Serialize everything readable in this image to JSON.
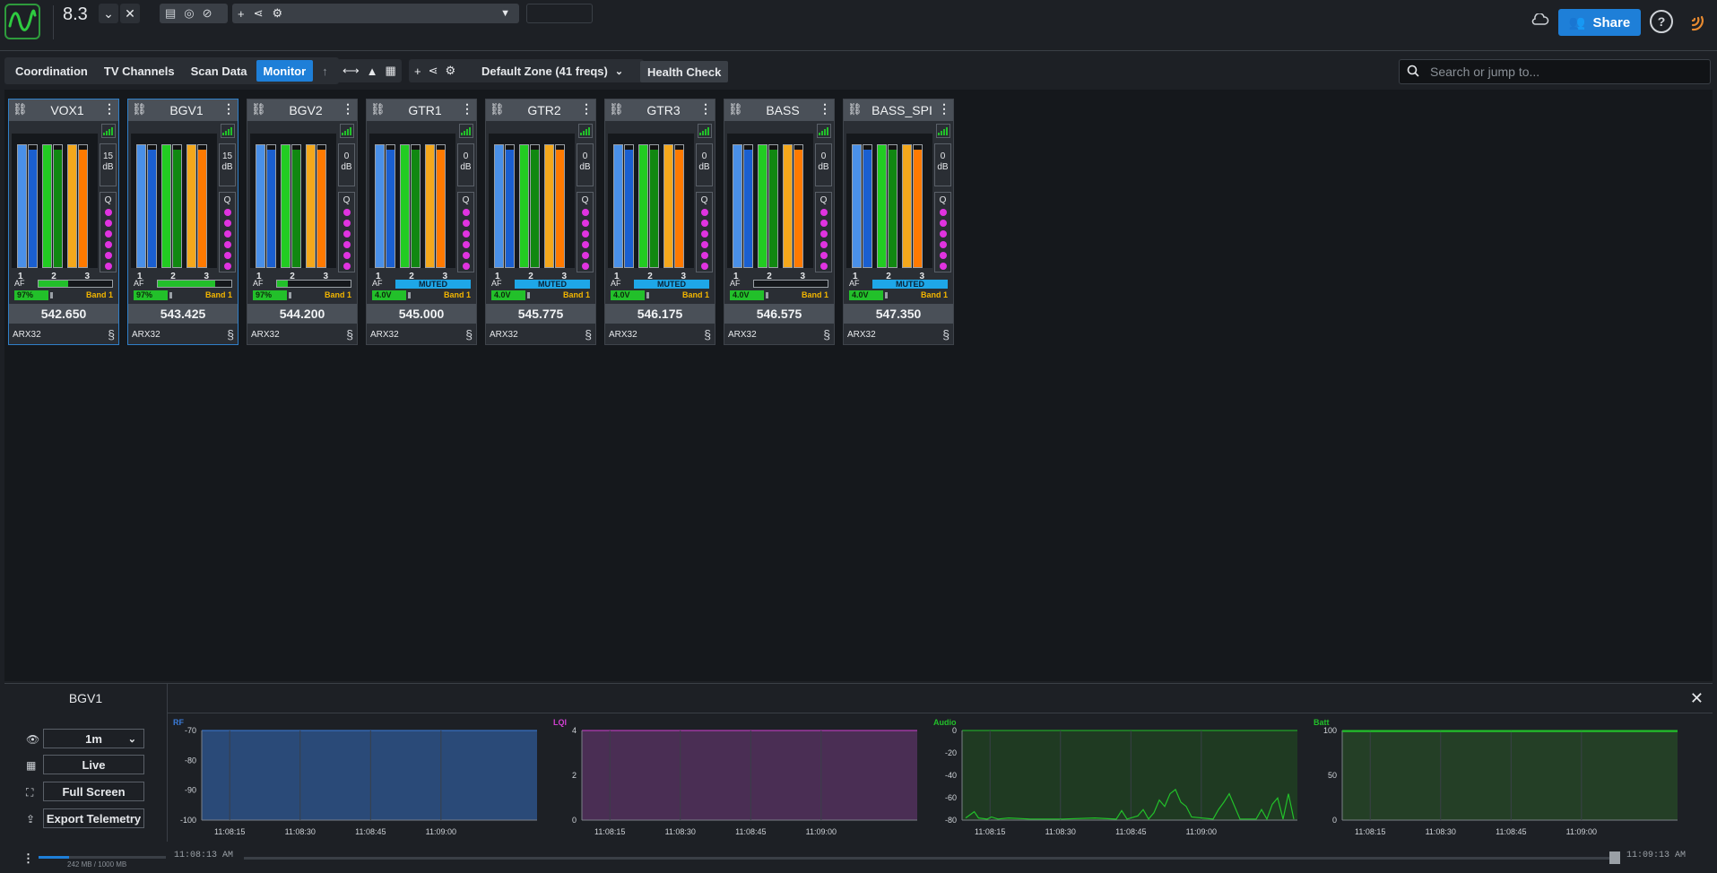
{
  "app": {
    "version": "8.3"
  },
  "toolbar": {
    "share_label": "Share"
  },
  "nav": {
    "tabs": [
      {
        "label": "Coordination",
        "active": false
      },
      {
        "label": "TV Channels",
        "active": false
      },
      {
        "label": "Scan Data",
        "active": false
      },
      {
        "label": "Monitor",
        "active": true
      }
    ],
    "zone_label": "Default Zone (41 freqs)",
    "health_check": "Health Check"
  },
  "search": {
    "placeholder": "Search or jump to..."
  },
  "channels": [
    {
      "name": "VOX1",
      "freq": "542.650",
      "model": "ARX32",
      "gain": "15",
      "gain_unit": "dB",
      "af_label": "AF",
      "af_level": 0.4,
      "muted": false,
      "battery": "97%",
      "band": "Band 1",
      "selected": true
    },
    {
      "name": "BGV1",
      "freq": "543.425",
      "model": "ARX32",
      "gain": "15",
      "gain_unit": "dB",
      "af_label": "AF",
      "af_level": 0.78,
      "muted": false,
      "battery": "97%",
      "band": "Band 1",
      "selected": true
    },
    {
      "name": "BGV2",
      "freq": "544.200",
      "model": "ARX32",
      "gain": "0",
      "gain_unit": "dB",
      "af_label": "AF",
      "af_level": 0.15,
      "muted": false,
      "battery": "97%",
      "band": "Band 1",
      "selected": false
    },
    {
      "name": "GTR1",
      "freq": "545.000",
      "model": "ARX32",
      "gain": "0",
      "gain_unit": "dB",
      "af_label": "AF",
      "af_level": 0,
      "muted": true,
      "muted_label": "MUTED",
      "battery": "4.0V",
      "band": "Band 1",
      "selected": false
    },
    {
      "name": "GTR2",
      "freq": "545.775",
      "model": "ARX32",
      "gain": "0",
      "gain_unit": "dB",
      "af_label": "AF",
      "af_level": 0,
      "muted": true,
      "muted_label": "MUTED",
      "battery": "4.0V",
      "band": "Band 1",
      "selected": false
    },
    {
      "name": "GTR3",
      "freq": "546.175",
      "model": "ARX32",
      "gain": "0",
      "gain_unit": "dB",
      "af_label": "AF",
      "af_level": 0,
      "muted": true,
      "muted_label": "MUTED",
      "battery": "4.0V",
      "band": "Band 1",
      "selected": false
    },
    {
      "name": "BASS",
      "freq": "546.575",
      "model": "ARX32",
      "gain": "0",
      "gain_unit": "dB",
      "af_label": "AF",
      "af_level": 0,
      "muted": false,
      "battery": "4.0V",
      "band": "Band 1",
      "selected": false
    },
    {
      "name": "BASS_SPI",
      "freq": "547.350",
      "model": "ARX32",
      "gain": "0",
      "gain_unit": "dB",
      "af_label": "AF",
      "af_level": 0,
      "muted": true,
      "muted_label": "MUTED",
      "battery": "4.0V",
      "band": "Band 1",
      "selected": false
    }
  ],
  "channel_numbers": [
    "1",
    "2",
    "3"
  ],
  "q_label": "Q",
  "bottom": {
    "device": "BGV1",
    "window_select": "1m",
    "live": "Live",
    "fullscreen": "Full Screen",
    "export": "Export Telemetry"
  },
  "plots": [
    {
      "title": "RF",
      "color": "#3b7bd8",
      "fill": "#2a4a78",
      "yticks": [
        "-70",
        "-80",
        "-90",
        "-100"
      ],
      "xticks": [
        "11:08:15",
        "11:08:30",
        "11:08:45",
        "11:09:00"
      ]
    },
    {
      "title": "LQI",
      "color": "#d040d0",
      "fill": "#4a2e54",
      "yticks": [
        "4",
        "2",
        "0"
      ],
      "xticks": [
        "11:08:15",
        "11:08:30",
        "11:08:45",
        "11:09:00"
      ]
    },
    {
      "title": "Audio",
      "color": "#22c02a",
      "fill": "#1f3a22",
      "yticks": [
        "0",
        "-20",
        "-40",
        "-60",
        "-80"
      ],
      "xticks": [
        "11:08:15",
        "11:08:30",
        "11:08:45",
        "11:09:00"
      ]
    },
    {
      "title": "Batt",
      "color": "#22c02a",
      "fill": "#243f26",
      "yticks": [
        "100",
        "50",
        "0"
      ],
      "xticks": [
        "11:08:15",
        "11:08:30",
        "11:08:45",
        "11:09:00"
      ]
    }
  ],
  "status": {
    "memory": "242 MB / 1000 MB",
    "memory_used": 0.242,
    "time_start": "11:08:13 AM",
    "time_end": "11:09:13 AM"
  }
}
